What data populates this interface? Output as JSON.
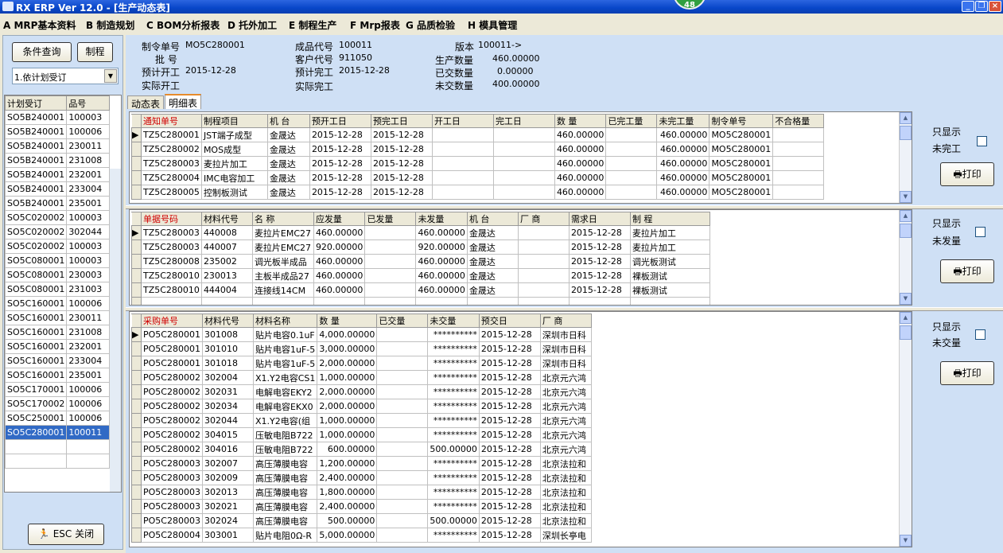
{
  "window": {
    "title": "RX ERP Ver 12.0 - [生产动态表]",
    "badge": "48"
  },
  "menu": [
    "A MRP基本资料",
    "B 制造规划",
    "C BOM分析报表",
    "D 托外加工",
    "E 制程生产",
    "F Mrp报表",
    "G 品质检验",
    "H 模具管理"
  ],
  "left": {
    "query_button": "条件查询",
    "make_button": "制程",
    "select_value": "1.依计划受订",
    "headers": [
      "计划受订",
      "品号"
    ],
    "rows": [
      [
        "SO5B240001",
        "100003"
      ],
      [
        "SO5B240001",
        "100006"
      ],
      [
        "SO5B240001",
        "230011"
      ],
      [
        "SO5B240001",
        "231008"
      ],
      [
        "SO5B240001",
        "232001"
      ],
      [
        "SO5B240001",
        "233004"
      ],
      [
        "SO5B240001",
        "235001"
      ],
      [
        "SO5C020002",
        "100003"
      ],
      [
        "SO5C020002",
        "302044"
      ],
      [
        "SO5C020002",
        "100003"
      ],
      [
        "SO5C080001",
        "100003"
      ],
      [
        "SO5C080001",
        "230003"
      ],
      [
        "SO5C080001",
        "231003"
      ],
      [
        "SO5C160001",
        "100006"
      ],
      [
        "SO5C160001",
        "230011"
      ],
      [
        "SO5C160001",
        "231008"
      ],
      [
        "SO5C160001",
        "232001"
      ],
      [
        "SO5C160001",
        "233004"
      ],
      [
        "SO5C160001",
        "235001"
      ],
      [
        "SO5C170001",
        "100006"
      ],
      [
        "SO5C170002",
        "100006"
      ],
      [
        "SO5C250001",
        "100006"
      ],
      [
        "SO5C280001",
        "100011"
      ]
    ],
    "selected_index": 22,
    "esc_button": "ESC 关闭"
  },
  "info": {
    "order_label": "制令单号",
    "order_value": "MO5C280001",
    "batch_label": "批  号",
    "batch_value": "",
    "plan_start_label": "预计开工",
    "plan_start_value": "2015-12-28",
    "actual_start_label": "实际开工",
    "actual_start_value": "",
    "product_label": "成品代号",
    "product_value": "100011",
    "customer_label": "客户代号",
    "customer_value": "911050",
    "plan_finish_label": "预计完工",
    "plan_finish_value": "2015-12-28",
    "actual_finish_label": "实际完工",
    "actual_finish_value": "",
    "version_label": "版本",
    "version_value": "100011->",
    "prod_qty_label": "生产数量",
    "prod_qty_value": "460.00000",
    "delivered_label": "已交数量",
    "delivered_value": "0.00000",
    "undelivered_label": "未交数量",
    "undelivered_value": "400.00000"
  },
  "tabs": [
    "动态表",
    "明细表"
  ],
  "grid1": {
    "headers": [
      "通知单号",
      "制程项目",
      "机  台",
      "预开工日",
      "预完工日",
      "开工日",
      "完工日",
      "数  量",
      "已完工量",
      "未完工量",
      "制令单号",
      "不合格量"
    ],
    "rows": [
      [
        "TZ5C280001",
        "JST端子成型",
        "金晟达",
        "2015-12-28",
        "2015-12-28",
        "",
        "",
        "460.00000",
        "",
        "460.00000",
        "MO5C280001",
        ""
      ],
      [
        "TZ5C280002",
        "MOS成型",
        "金晟达",
        "2015-12-28",
        "2015-12-28",
        "",
        "",
        "460.00000",
        "",
        "460.00000",
        "MO5C280001",
        ""
      ],
      [
        "TZ5C280003",
        "麦拉片加工",
        "金晟达",
        "2015-12-28",
        "2015-12-28",
        "",
        "",
        "460.00000",
        "",
        "460.00000",
        "MO5C280001",
        ""
      ],
      [
        "TZ5C280004",
        "IMC电容加工",
        "金晟达",
        "2015-12-28",
        "2015-12-28",
        "",
        "",
        "460.00000",
        "",
        "460.00000",
        "MO5C280001",
        ""
      ],
      [
        "TZ5C280005",
        "控制板测试",
        "金晟达",
        "2015-12-28",
        "2015-12-28",
        "",
        "",
        "460.00000",
        "",
        "460.00000",
        "MO5C280001",
        ""
      ]
    ]
  },
  "grid2": {
    "headers": [
      "单据号码",
      "材料代号",
      "名  称",
      "应发量",
      "已发量",
      "未发量",
      "机  台",
      "厂  商",
      "需求日",
      "制  程"
    ],
    "rows": [
      [
        "TZ5C280003",
        "440008",
        "麦拉片EMC27",
        "460.00000",
        "",
        "460.00000",
        "金晟达",
        "",
        "2015-12-28",
        "麦拉片加工"
      ],
      [
        "TZ5C280003",
        "440007",
        "麦拉片EMC27",
        "920.00000",
        "",
        "920.00000",
        "金晟达",
        "",
        "2015-12-28",
        "麦拉片加工"
      ],
      [
        "TZ5C280008",
        "235002",
        "调光板半成品",
        "460.00000",
        "",
        "460.00000",
        "金晟达",
        "",
        "2015-12-28",
        "调光板测试"
      ],
      [
        "TZ5C280010",
        "230013",
        "主板半成品27",
        "460.00000",
        "",
        "460.00000",
        "金晟达",
        "",
        "2015-12-28",
        "裸板测试"
      ],
      [
        "TZ5C280010",
        "444004",
        "连接线14CM",
        "460.00000",
        "",
        "460.00000",
        "金晟达",
        "",
        "2015-12-28",
        "裸板测试"
      ]
    ]
  },
  "grid3": {
    "headers": [
      "采购单号",
      "材料代号",
      "材料名称",
      "数  量",
      "已交量",
      "未交量",
      "预交日",
      "厂  商"
    ],
    "rows": [
      [
        "PO5C280001",
        "301008",
        "贴片电容0.1uF",
        "4,000.00000",
        "",
        "**********",
        "2015-12-28",
        "深圳市日科"
      ],
      [
        "PO5C280001",
        "301010",
        "贴片电容1uF-5",
        "3,000.00000",
        "",
        "**********",
        "2015-12-28",
        "深圳市日科"
      ],
      [
        "PO5C280001",
        "301018",
        "贴片电容1uF-5",
        "2,000.00000",
        "",
        "**********",
        "2015-12-28",
        "深圳市日科"
      ],
      [
        "PO5C280002",
        "302004",
        "X1.Y2电容CS1",
        "1,000.00000",
        "",
        "**********",
        "2015-12-28",
        "北京元六鸿"
      ],
      [
        "PO5C280002",
        "302031",
        "电解电容EKY2",
        "2,000.00000",
        "",
        "**********",
        "2015-12-28",
        "北京元六鸿"
      ],
      [
        "PO5C280002",
        "302034",
        "电解电容EKX0",
        "2,000.00000",
        "",
        "**********",
        "2015-12-28",
        "北京元六鸿"
      ],
      [
        "PO5C280002",
        "302044",
        "X1.Y2电容(组",
        "1,000.00000",
        "",
        "**********",
        "2015-12-28",
        "北京元六鸿"
      ],
      [
        "PO5C280002",
        "304015",
        "压敏电阻B722",
        "1,000.00000",
        "",
        "**********",
        "2015-12-28",
        "北京元六鸿"
      ],
      [
        "PO5C280002",
        "304016",
        "压敏电阻B722",
        "600.00000",
        "",
        "500.00000",
        "2015-12-28",
        "北京元六鸿"
      ],
      [
        "PO5C280003",
        "302007",
        "高压薄膜电容",
        "1,200.00000",
        "",
        "**********",
        "2015-12-28",
        "北京法拉和"
      ],
      [
        "PO5C280003",
        "302009",
        "高压薄膜电容",
        "2,400.00000",
        "",
        "**********",
        "2015-12-28",
        "北京法拉和"
      ],
      [
        "PO5C280003",
        "302013",
        "高压薄膜电容",
        "1,800.00000",
        "",
        "**********",
        "2015-12-28",
        "北京法拉和"
      ],
      [
        "PO5C280003",
        "302021",
        "高压薄膜电容",
        "2,400.00000",
        "",
        "**********",
        "2015-12-28",
        "北京法拉和"
      ],
      [
        "PO5C280003",
        "302024",
        "高压薄膜电容",
        "500.00000",
        "",
        "500.00000",
        "2015-12-28",
        "北京法拉和"
      ],
      [
        "PO5C280004",
        "303001",
        "贴片电阻0Ω-R",
        "5,000.00000",
        "",
        "**********",
        "2015-12-28",
        "深圳长亭电"
      ]
    ]
  },
  "panels": [
    {
      "line1": "只显示",
      "line2": "未完工",
      "print": "打印"
    },
    {
      "line1": "只显示",
      "line2": "未发量",
      "print": "打印"
    },
    {
      "line1": "只显示",
      "line2": "未交量",
      "print": "打印"
    }
  ]
}
